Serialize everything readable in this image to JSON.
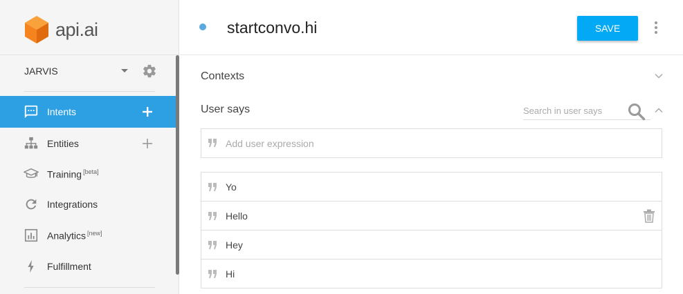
{
  "brand": {
    "name": "api.ai"
  },
  "agent": {
    "name": "JARVIS"
  },
  "nav": {
    "items": [
      {
        "label": "Intents",
        "sup": "",
        "icon": "chat-icon",
        "active": true
      },
      {
        "label": "Entities",
        "sup": "",
        "icon": "hierarchy-icon",
        "active": false
      },
      {
        "label": "Training",
        "sup": "[beta]",
        "icon": "graduation-cap-icon",
        "active": false
      },
      {
        "label": "Integrations",
        "sup": "",
        "icon": "refresh-icon",
        "active": false
      },
      {
        "label": "Analytics",
        "sup": "[new]",
        "icon": "bar-chart-icon",
        "active": false
      },
      {
        "label": "Fulfillment",
        "sup": "",
        "icon": "lightning-icon",
        "active": false
      }
    ]
  },
  "header": {
    "intent_name": "startconvo.hi",
    "save_label": "SAVE"
  },
  "contexts": {
    "title": "Contexts"
  },
  "user_says": {
    "title": "User says",
    "search_placeholder": "Search in user says",
    "add_placeholder": "Add user expression",
    "expressions": [
      "Yo",
      "Hello",
      "Hey",
      "Hi"
    ]
  },
  "colors": {
    "accent": "#03a9f4",
    "active_nav": "#2da0e4",
    "logo_orange": "#f5841f"
  }
}
